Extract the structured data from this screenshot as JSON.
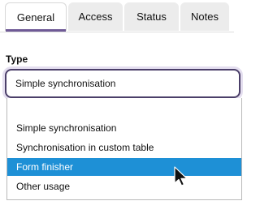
{
  "tabs": [
    {
      "label": "General",
      "active": true
    },
    {
      "label": "Access",
      "active": false
    },
    {
      "label": "Status",
      "active": false
    },
    {
      "label": "Notes",
      "active": false
    }
  ],
  "field": {
    "label": "Type",
    "selected_value": "Simple synchronisation"
  },
  "dropdown": {
    "options": [
      {
        "label": "",
        "highlighted": false
      },
      {
        "label": "Simple synchronisation",
        "highlighted": false
      },
      {
        "label": "Synchronisation in custom table",
        "highlighted": false
      },
      {
        "label": "Form finisher",
        "highlighted": true
      },
      {
        "label": "Other usage",
        "highlighted": false
      }
    ]
  },
  "colors": {
    "accent": "#6f5a96",
    "highlight": "#1e90d6"
  },
  "icons": {
    "cursor": "mouse-pointer-icon"
  }
}
